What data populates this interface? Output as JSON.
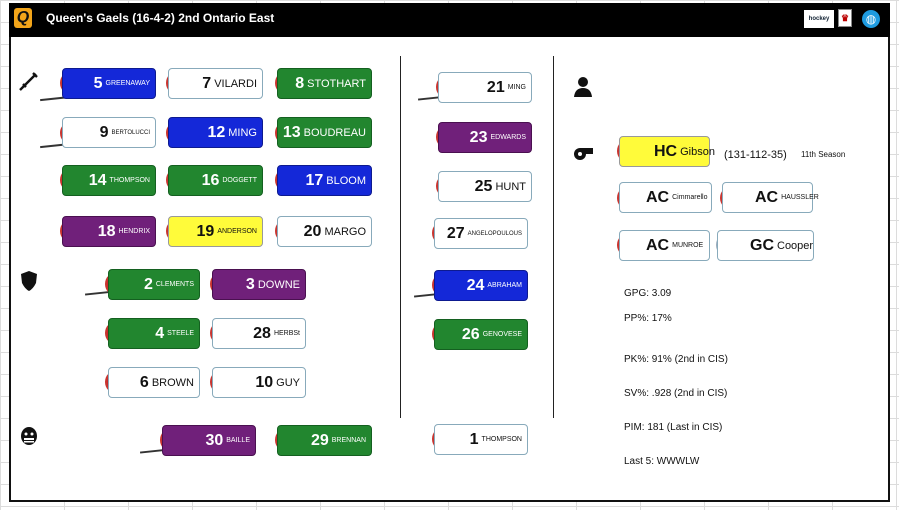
{
  "header": {
    "logo": "Q",
    "title": "Queen's Gaels (16-4-2) 2nd Ontario East",
    "hockey_logo": "hockey",
    "shield": "♛",
    "globe": "◍"
  },
  "icons": {
    "forwards": "sword-icon",
    "defense": "shield-icon",
    "goalies": "goalie-mask-icon",
    "coach": "person-icon",
    "whistle": "whistle-icon"
  },
  "forwards": [
    {
      "num": "5",
      "name": "GREENAWAY",
      "color": "blue"
    },
    {
      "num": "7",
      "name": "VILARDI",
      "color": "white"
    },
    {
      "num": "8",
      "name": "STOTHART",
      "color": "green"
    },
    {
      "num": "9",
      "name": "BERTOLUCCI",
      "color": "white"
    },
    {
      "num": "12",
      "name": "MING",
      "color": "blue"
    },
    {
      "num": "13",
      "name": "BOUDREAU",
      "color": "green"
    },
    {
      "num": "14",
      "name": "THOMPSON",
      "color": "green"
    },
    {
      "num": "16",
      "name": "DOGGETT",
      "color": "green"
    },
    {
      "num": "17",
      "name": "BLOOM",
      "color": "blue"
    },
    {
      "num": "18",
      "name": "HENDRIX",
      "color": "purple"
    },
    {
      "num": "19",
      "name": "ANDERSON",
      "color": "yellow"
    },
    {
      "num": "20",
      "name": "MARGO",
      "color": "white"
    }
  ],
  "defense": [
    {
      "num": "2",
      "name": "CLEMENTS",
      "color": "green"
    },
    {
      "num": "3",
      "name": "DOWNE",
      "color": "purple"
    },
    {
      "num": "4",
      "name": "STEELE",
      "color": "green"
    },
    {
      "num": "28",
      "name": "HERBSt",
      "color": "white"
    },
    {
      "num": "6",
      "name": "BROWN",
      "color": "white"
    },
    {
      "num": "10",
      "name": "GUY",
      "color": "white"
    }
  ],
  "goalies": [
    {
      "num": "30",
      "name": "BAILLE",
      "color": "purple"
    },
    {
      "num": "29",
      "name": "BRENNAN",
      "color": "green"
    }
  ],
  "extras": [
    {
      "num": "21",
      "name": "MING",
      "color": "white"
    },
    {
      "num": "23",
      "name": "EDWARDS",
      "color": "purple"
    },
    {
      "num": "25",
      "name": "HUNT",
      "color": "white"
    },
    {
      "num": "27",
      "name": "ANGELOPOULOUS",
      "color": "white"
    },
    {
      "num": "24",
      "name": "ABRAHAM",
      "color": "blue"
    },
    {
      "num": "26",
      "name": "GENOVESE",
      "color": "green"
    },
    {
      "num": "1",
      "name": "THOMPSON",
      "color": "white"
    }
  ],
  "coaches": {
    "hc": {
      "role": "HC",
      "name": "Gibson"
    },
    "record": "(131-112-35)",
    "season": "11th Season",
    "ac1": {
      "role": "AC",
      "name": "Cimmarello"
    },
    "ac2": {
      "role": "AC",
      "name": "HAUSSLER"
    },
    "ac3": {
      "role": "AC",
      "name": "MUNROE"
    },
    "gc": {
      "role": "GC",
      "name": "Cooper"
    }
  },
  "stats": {
    "gpg": "GPG: 3.09",
    "pp": "PP%: 17%",
    "pk": "PK%: 91% (2nd in CIS)",
    "sv": "SV%: .928 (2nd in CIS)",
    "pim": "PIM: 181 (Last in CIS)",
    "last5": "Last 5: WWWLW"
  }
}
